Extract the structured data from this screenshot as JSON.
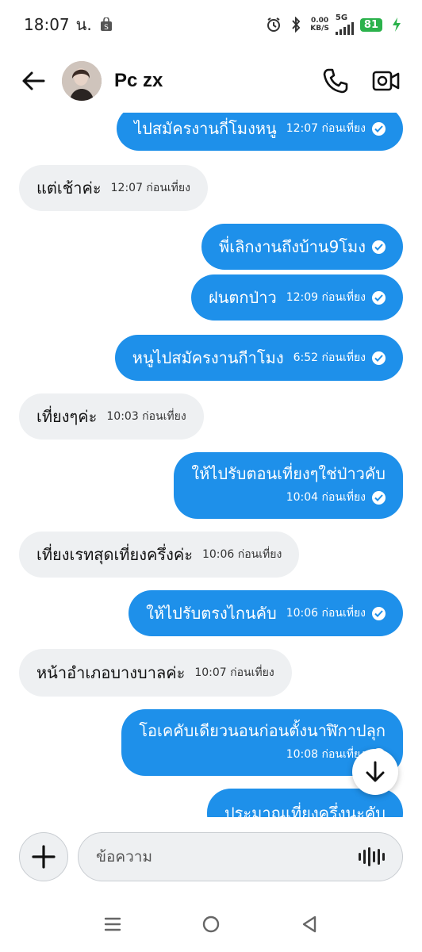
{
  "status_bar": {
    "time": "18:07",
    "suffix": "น.",
    "net_speed_value": "0.00",
    "net_speed_unit": "KB/S",
    "network": "5G",
    "battery": "81"
  },
  "header": {
    "contact_name": "Pc zx"
  },
  "messages": [
    {
      "dir": "out",
      "text": "ไปสมัครงานกี่โมงหนู",
      "time": "12:07 ก่อนเที่ยง"
    },
    {
      "dir": "in",
      "text": "แต่เช้าค่ะ",
      "time": "12:07 ก่อนเที่ยง"
    },
    {
      "dir": "out",
      "text": "พี่เลิกงานถึงบ้าน9โมง",
      "time": ""
    },
    {
      "dir": "out",
      "text": "ฝนตกป่าว",
      "time": "12:09 ก่อนเที่ยง"
    },
    {
      "dir": "out",
      "text": "หนูไปสมัครงานกีาโมง",
      "time": "6:52 ก่อนเที่ยง"
    },
    {
      "dir": "in",
      "text": "เที่ยงๆค่ะ",
      "time": "10:03 ก่อนเที่ยง"
    },
    {
      "dir": "out",
      "text": "ให้ไปรับตอนเที่ยงๆใช่ป่าวคับ",
      "time": "10:04 ก่อนเที่ยง"
    },
    {
      "dir": "in",
      "text": "เที่ยงเรทสุดเที่ยงครึ่งค่ะ",
      "time": "10:06 ก่อนเที่ยง"
    },
    {
      "dir": "out",
      "text": "ให้ไปรับตรงไกนคับ",
      "time": "10:06 ก่อนเที่ยง"
    },
    {
      "dir": "in",
      "text": "หน้าอำเภอบางบาลค่ะ",
      "time": "10:07 ก่อนเที่ยง"
    },
    {
      "dir": "out",
      "text": "โอเคคับเดียวนอนก่อนตั้งนาฬิกาปลุก",
      "time": "10:08 ก่อนเที่ยง"
    },
    {
      "dir": "out",
      "text": "ประมาณเที่ยงครึ่งนะคับ",
      "time": ""
    }
  ],
  "composer": {
    "placeholder": "ข้อความ"
  },
  "icons": {
    "back": "arrow-left-icon",
    "call": "phone-icon",
    "video": "video-camera-icon",
    "add": "plus-icon",
    "voice": "voice-wave-icon",
    "scroll": "arrow-down-icon"
  },
  "colors": {
    "outgoing_bubble": "#1e90ea",
    "incoming_bubble": "#eef0f2",
    "battery": "#2bb24c"
  }
}
